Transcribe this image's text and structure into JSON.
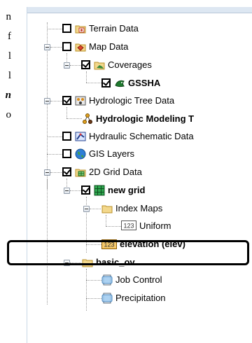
{
  "document": {
    "lines": [
      "n",
      "f",
      "l",
      "l",
      "n",
      "o"
    ]
  },
  "tree": {
    "items": [
      {
        "label": "Terrain Data",
        "checked": false,
        "icon": "terrain-data-icon"
      },
      {
        "label": "Map Data",
        "checked": false,
        "icon": "map-data-icon"
      },
      {
        "label": "Coverages",
        "checked": true,
        "icon": "coverages-folder-icon"
      },
      {
        "label": "GSSHA",
        "checked": true,
        "icon": "gssha-coverage-icon"
      },
      {
        "label": "Hydrologic Tree Data",
        "checked": true,
        "icon": "hydrologic-tree-icon"
      },
      {
        "label": "Hydrologic Modeling T",
        "icon": "hydrologic-model-icon"
      },
      {
        "label": "Hydraulic Schematic Data",
        "checked": false,
        "icon": "hydraulic-schematic-icon"
      },
      {
        "label": "GIS Layers",
        "checked": false,
        "icon": "gis-globe-icon"
      },
      {
        "label": "2D Grid Data",
        "checked": true,
        "icon": "grid-data-icon"
      },
      {
        "label": "new grid",
        "checked": true,
        "icon": "grid-icon"
      },
      {
        "label": "Index Maps",
        "icon": "folder-icon"
      },
      {
        "label": "Uniform",
        "icon": "dataset-123-icon"
      },
      {
        "label": "elevation (elev)",
        "icon": "dataset-123-icon"
      },
      {
        "label": "basic_ov",
        "icon": "folder-icon"
      },
      {
        "label": "Job Control",
        "icon": "job-control-icon"
      },
      {
        "label": "Precipitation",
        "icon": "precipitation-icon"
      }
    ]
  },
  "colors": {
    "highlight_border": "#000000",
    "panel_border": "#c9d7e6",
    "tree_lines": "#9a9a9a"
  }
}
